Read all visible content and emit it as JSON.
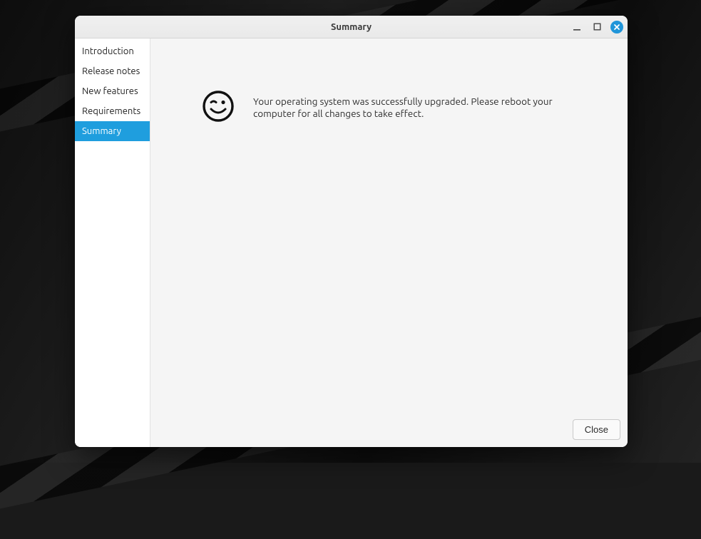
{
  "window": {
    "title": "Summary"
  },
  "sidebar": {
    "items": [
      {
        "label": "Introduction",
        "active": false
      },
      {
        "label": "Release notes",
        "active": false
      },
      {
        "label": "New features",
        "active": false
      },
      {
        "label": "Requirements",
        "active": false
      },
      {
        "label": "Summary",
        "active": true
      }
    ]
  },
  "content": {
    "icon": "wink-smiley-icon",
    "message": "Your operating system was successfully upgraded. Please reboot your computer for all changes to take effect."
  },
  "footer": {
    "close_label": "Close"
  },
  "titlebar_controls": {
    "minimize": "minimize-icon",
    "maximize": "maximize-icon",
    "close": "close-icon"
  },
  "colors": {
    "accent": "#1f9ede",
    "close_btn": "#2095d9"
  }
}
